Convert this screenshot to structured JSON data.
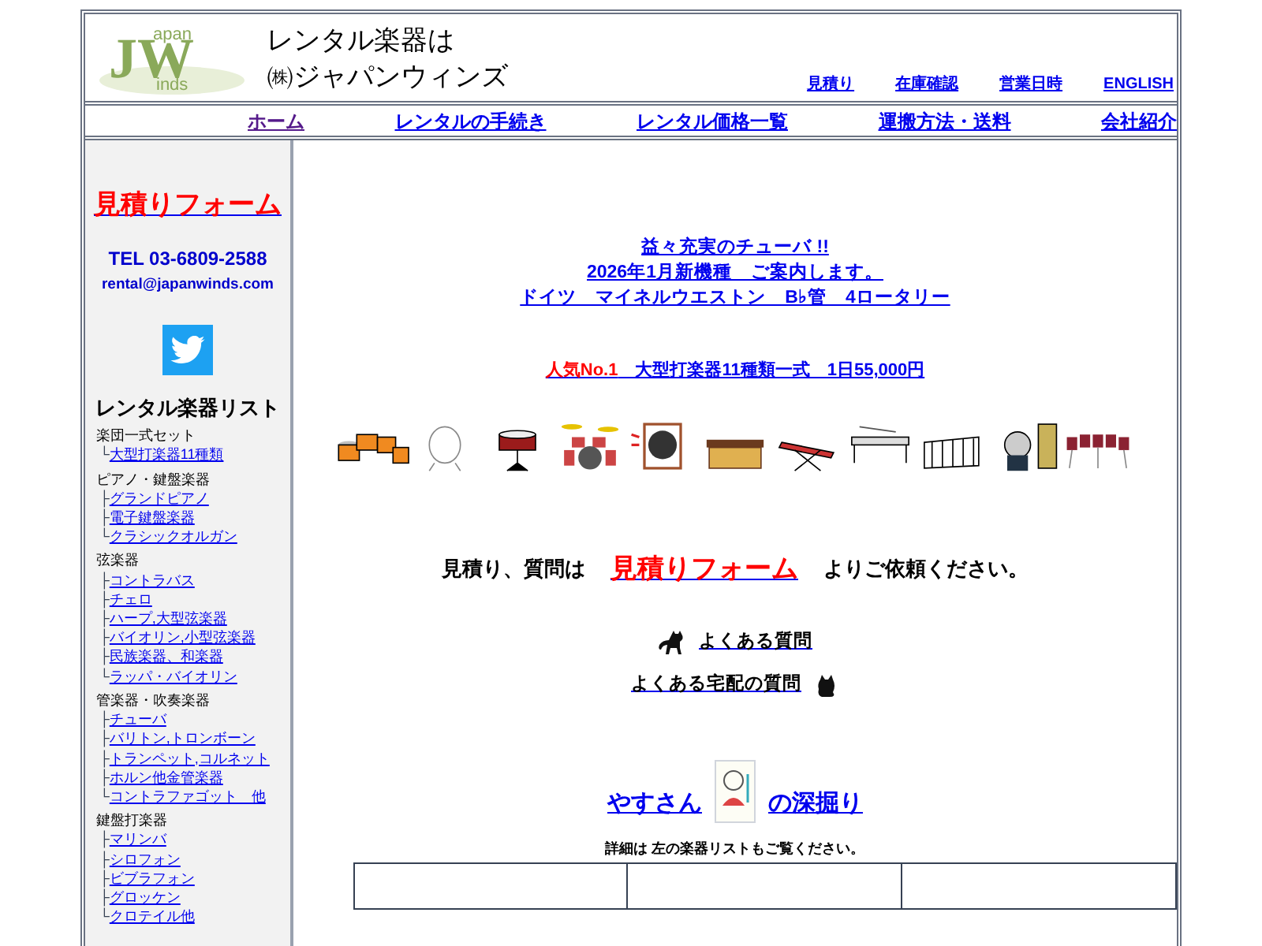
{
  "header": {
    "logo": {
      "big": "JW",
      "top": "apan",
      "bottom": "inds"
    },
    "title_lines": [
      "レンタル楽器は",
      "㈱ジャパンウィンズ"
    ],
    "top_links": [
      "見積り",
      "在庫確認",
      "営業日時",
      "ENGLISH"
    ]
  },
  "nav": [
    {
      "label": "ホーム",
      "visited": true
    },
    {
      "label": "レンタルの手続き",
      "visited": false
    },
    {
      "label": "レンタル価格一覧",
      "visited": false
    },
    {
      "label": "運搬方法・送料",
      "visited": false
    },
    {
      "label": "会社紹介",
      "visited": false
    }
  ],
  "sidebar": {
    "form_link": "見積りフォーム",
    "tel": "TEL 03-6809-2588",
    "email": "rental@japanwinds.com",
    "list_title": "レンタル楽器リスト",
    "groups": [
      {
        "name": "楽団一式セット",
        "items": [
          {
            "branch": "└",
            "label": "大型打楽器11種類"
          }
        ]
      },
      {
        "name": "ピアノ・鍵盤楽器",
        "items": [
          {
            "branch": "├",
            "label": "グランドピアノ"
          },
          {
            "branch": "├",
            "label": "電子鍵盤楽器"
          },
          {
            "branch": "└",
            "label": "クラシックオルガン"
          }
        ]
      },
      {
        "name": "弦楽器",
        "items": [
          {
            "branch": "├",
            "label": "コントラバス"
          },
          {
            "branch": "├",
            "label": "チェロ"
          },
          {
            "branch": "├",
            "label": "ハープ,大型弦楽器"
          },
          {
            "branch": "├",
            "label": "バイオリン,小型弦楽器"
          },
          {
            "branch": "├",
            "label": "民族楽器、和楽器"
          },
          {
            "branch": "└",
            "label": "ラッパ・バイオリン"
          }
        ]
      },
      {
        "name": "管楽器・吹奏楽器",
        "items": [
          {
            "branch": "├",
            "label": "チューバ"
          },
          {
            "branch": "├",
            "label": "バリトン,トロンボーン"
          },
          {
            "branch": "├",
            "label": "トランペット,コルネット"
          },
          {
            "branch": "├",
            "label": "ホルン他金管楽器"
          },
          {
            "branch": "└",
            "label": "コントラファゴット　他"
          }
        ]
      },
      {
        "name": "鍵盤打楽器",
        "items": [
          {
            "branch": "├",
            "label": "マリンバ"
          },
          {
            "branch": "├",
            "label": "シロフォン"
          },
          {
            "branch": "├",
            "label": "ビブラフォン"
          },
          {
            "branch": "├",
            "label": "グロッケン"
          },
          {
            "branch": "└",
            "label": "クロテイル他"
          }
        ]
      }
    ]
  },
  "main": {
    "news_lines": [
      "益々充実のチューバ !!",
      "2026年1月新機種　ご案内します。",
      "ドイツ　マイネルウエストン　B♭管　4ロータリー"
    ],
    "popular": {
      "tag": "人気No.1",
      "text": "　大型打楽器11種類一式　1日55,000円"
    },
    "inquiry": {
      "before": "見積り、質問は",
      "link": "見積りフォーム",
      "after": "よりご依頼ください。"
    },
    "faq_links": [
      {
        "label": "よくある質問",
        "kind": "walking-cat"
      },
      {
        "label": "よくある宅配の質問",
        "kind": "sitting-cat"
      }
    ],
    "feature": {
      "before": "やすさん",
      "after": "の深掘り"
    },
    "note": "詳細は 左の楽器リストもご覧ください。"
  }
}
